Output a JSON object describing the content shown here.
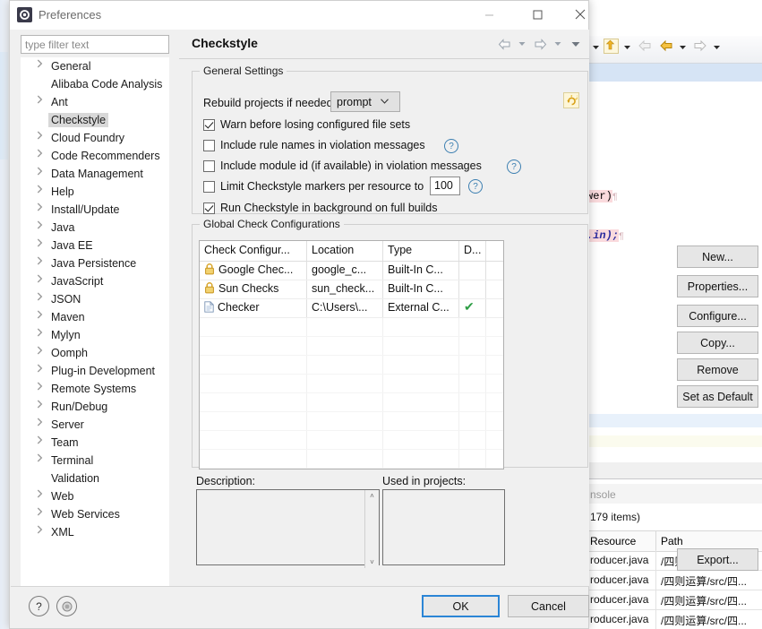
{
  "dialog": {
    "title": "Preferences",
    "icon": "preferences-gear-icon",
    "window_controls": {
      "minimize": "—",
      "maximize": "☐",
      "close": "✕"
    }
  },
  "filter": {
    "placeholder": "type filter text",
    "value": ""
  },
  "tree": {
    "items": [
      {
        "label": "General",
        "expandable": true,
        "selected": false
      },
      {
        "label": "Alibaba Code Analysis",
        "expandable": false,
        "selected": false
      },
      {
        "label": "Ant",
        "expandable": true,
        "selected": false
      },
      {
        "label": "Checkstyle",
        "expandable": false,
        "selected": true
      },
      {
        "label": "Cloud Foundry",
        "expandable": true,
        "selected": false
      },
      {
        "label": "Code Recommenders",
        "expandable": true,
        "selected": false
      },
      {
        "label": "Data Management",
        "expandable": true,
        "selected": false
      },
      {
        "label": "Help",
        "expandable": true,
        "selected": false
      },
      {
        "label": "Install/Update",
        "expandable": true,
        "selected": false
      },
      {
        "label": "Java",
        "expandable": true,
        "selected": false
      },
      {
        "label": "Java EE",
        "expandable": true,
        "selected": false
      },
      {
        "label": "Java Persistence",
        "expandable": true,
        "selected": false
      },
      {
        "label": "JavaScript",
        "expandable": true,
        "selected": false
      },
      {
        "label": "JSON",
        "expandable": true,
        "selected": false
      },
      {
        "label": "Maven",
        "expandable": true,
        "selected": false
      },
      {
        "label": "Mylyn",
        "expandable": true,
        "selected": false
      },
      {
        "label": "Oomph",
        "expandable": true,
        "selected": false
      },
      {
        "label": "Plug-in Development",
        "expandable": true,
        "selected": false
      },
      {
        "label": "Remote Systems",
        "expandable": true,
        "selected": false
      },
      {
        "label": "Run/Debug",
        "expandable": true,
        "selected": false
      },
      {
        "label": "Server",
        "expandable": true,
        "selected": false
      },
      {
        "label": "Team",
        "expandable": true,
        "selected": false
      },
      {
        "label": "Terminal",
        "expandable": true,
        "selected": false
      },
      {
        "label": "Validation",
        "expandable": false,
        "selected": false
      },
      {
        "label": "Web",
        "expandable": true,
        "selected": false
      },
      {
        "label": "Web Services",
        "expandable": true,
        "selected": false
      },
      {
        "label": "XML",
        "expandable": true,
        "selected": false
      }
    ]
  },
  "page": {
    "title": "Checkstyle",
    "nav": {
      "back": "back-arrow-icon",
      "back_menu": "chevron-down-icon",
      "forward": "forward-arrow-icon",
      "forward_menu": "chevron-down-icon",
      "view_menu": "chevron-down-icon"
    }
  },
  "general_settings": {
    "group_title": "General Settings",
    "rebuild_label": "Rebuild projects if needed:",
    "rebuild_value": "prompt",
    "rebuild_caret": "˅",
    "refresh_icon": "refresh-icon",
    "checkboxes": [
      {
        "label": "Warn before losing configured file sets",
        "checked": true,
        "help": false
      },
      {
        "label": "Include rule names in violation messages",
        "checked": false,
        "help": true
      },
      {
        "label": "Include module id (if available) in violation messages",
        "checked": false,
        "help": true
      },
      {
        "label": "Limit Checkstyle markers per resource to",
        "checked": false,
        "help": true
      },
      {
        "label": "Run Checkstyle in background on full builds",
        "checked": true,
        "help": false
      }
    ],
    "marker_limit": "100",
    "help_glyph": "?"
  },
  "global_configs": {
    "group_title": "Global Check Configurations",
    "columns": [
      "Check Configur...",
      "Location",
      "Type",
      "D..."
    ],
    "rows": [
      {
        "icon": "lock-icon",
        "name": "Google Chec...",
        "location": "google_c...",
        "type": "Built-In C...",
        "default": ""
      },
      {
        "icon": "lock-icon",
        "name": "Sun Checks",
        "location": "sun_check...",
        "type": "Built-In C...",
        "default": ""
      },
      {
        "icon": "file-icon",
        "name": "Checker",
        "location": "C:\\Users\\...",
        "type": "External C...",
        "default": "✔"
      }
    ],
    "buttons": [
      {
        "label": "New...",
        "name": "new-button"
      },
      {
        "label": "Properties...",
        "name": "properties-button"
      },
      {
        "label": "Configure...",
        "name": "configure-button"
      },
      {
        "label": "Copy...",
        "name": "copy-button"
      },
      {
        "label": "Remove",
        "name": "remove-button"
      },
      {
        "label": "Set as Default",
        "name": "set-as-default-button"
      }
    ]
  },
  "details": {
    "description_label": "Description:",
    "description_value": "",
    "used_in_projects_label": "Used in projects:",
    "used_in_projects_value": "",
    "export_label": "Export...",
    "scroll_up": "˄",
    "scroll_down": "˅"
  },
  "footer": {
    "help_icon": "?",
    "apply_icon": "apply-icon",
    "ok_label": "OK",
    "cancel_label": "Cancel"
  },
  "background": {
    "toolbar_icons": [
      "up-arrow-icon",
      "chevron-down-icon",
      "back-arrow-disabled-icon",
      "back-arrow-icon",
      "chevron-down-icon",
      "forward-arrow-icon",
      "chevron-down-icon"
    ],
    "code_lines": [
      {
        "text": "wer)",
        "suffix": "¶"
      },
      {
        "text": ".in);",
        "suffix": "¶"
      }
    ],
    "console_label": "nsole",
    "items_label": "179 items)",
    "problems_columns": [
      "Resource",
      "Path"
    ],
    "problems_rows": [
      {
        "resource": "roducer.java",
        "path": "/四则运算/src/四..."
      },
      {
        "resource": "roducer.java",
        "path": "/四则运算/src/四..."
      },
      {
        "resource": "roducer.java",
        "path": "/四则运算/src/四..."
      },
      {
        "resource": "roducer.java",
        "path": "/四则运算/src/四..."
      }
    ]
  },
  "colors": {
    "dialog_bg": "#f0f0f0",
    "accent_blue": "#2b85d6",
    "selection": "#d8d8d8",
    "check_green": "#2e9e45",
    "lock_yellow": "#e8b93a"
  }
}
